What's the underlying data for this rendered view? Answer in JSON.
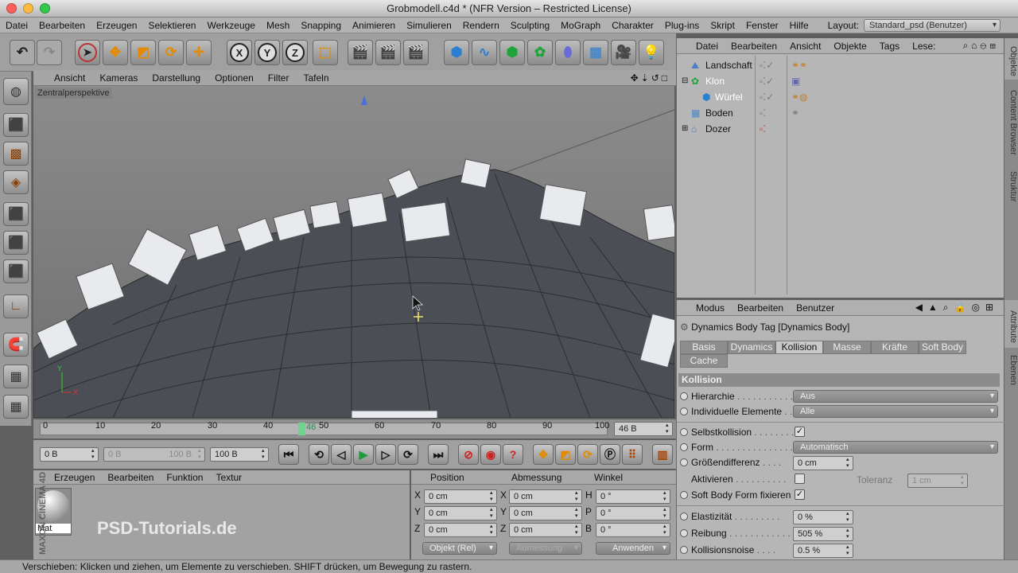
{
  "window": {
    "title": "Grobmodell.c4d * (NFR Version – Restricted License)"
  },
  "menu": [
    "Datei",
    "Bearbeiten",
    "Erzeugen",
    "Selektieren",
    "Werkzeuge",
    "Mesh",
    "Snapping",
    "Animieren",
    "Simulieren",
    "Rendern",
    "Sculpting",
    "MoGraph",
    "Charakter",
    "Plug-ins",
    "Skript",
    "Fenster",
    "Hilfe"
  ],
  "layout": {
    "label": "Layout:",
    "value": "Standard_psd (Benutzer)"
  },
  "viewport": {
    "menu": [
      "Ansicht",
      "Kameras",
      "Darstellung",
      "Optionen",
      "Filter",
      "Tafeln"
    ],
    "perspective_label": "Zentralperspektive",
    "nav_icons": "✥⇣↺□"
  },
  "timeline": {
    "ticks": [
      "0",
      "10",
      "20",
      "30",
      "40",
      "50",
      "60",
      "70",
      "80",
      "90",
      "100"
    ],
    "current": "46",
    "frame_field": "46 B"
  },
  "transport": {
    "start": "0 B",
    "range_start": "0 B",
    "range_end": "100 B",
    "end": "100 B"
  },
  "materials": {
    "menu": [
      "Erzeugen",
      "Bearbeiten",
      "Funktion",
      "Textur"
    ],
    "material_name": "Mat"
  },
  "coordinates": {
    "headers": [
      "Position",
      "Abmessung",
      "Winkel"
    ],
    "rows": [
      {
        "a": "X",
        "pos": "0 cm",
        "b": "X",
        "size": "0 cm",
        "c": "H",
        "rot": "0 °"
      },
      {
        "a": "Y",
        "pos": "0 cm",
        "b": "Y",
        "size": "0 cm",
        "c": "P",
        "rot": "0 °"
      },
      {
        "a": "Z",
        "pos": "0 cm",
        "b": "Z",
        "size": "0 cm",
        "c": "B",
        "rot": "0 °"
      }
    ],
    "mode": "Objekt (Rel)",
    "size_mode": "Abmessung",
    "apply": "Anwenden"
  },
  "objects": {
    "menu": [
      "Datei",
      "Bearbeiten",
      "Ansicht",
      "Objekte",
      "Tags",
      "Lese:"
    ],
    "items": [
      "Landschaft",
      "Klon",
      "Würfel",
      "Boden",
      "Dozer"
    ]
  },
  "side_tabs": {
    "right_top": [
      "Objekte",
      "Content Browser",
      "Struktur"
    ],
    "right_bottom": [
      "Attribute",
      "Ebenen"
    ]
  },
  "attributes": {
    "menu": [
      "Modus",
      "Bearbeiten",
      "Benutzer"
    ],
    "title": "Dynamics Body Tag [Dynamics Body]",
    "tabs": [
      "Basis",
      "Dynamics",
      "Kollision",
      "Masse",
      "Kräfte",
      "Soft Body",
      "Cache"
    ],
    "section": "Kollision",
    "hierarchie": {
      "label": "Hierarchie",
      "value": "Aus"
    },
    "individuelle": {
      "label": "Individuelle Elemente",
      "value": "Alle"
    },
    "selbst": {
      "label": "Selbstkollision",
      "checked": true
    },
    "form": {
      "label": "Form",
      "value": "Automatisch"
    },
    "groesse": {
      "label": "Größendifferenz",
      "value": "0 cm"
    },
    "aktivieren": {
      "label": "Aktivieren"
    },
    "toleranz": {
      "label": "Toleranz",
      "value": "1 cm"
    },
    "softbody": {
      "label": "Soft Body Form fixieren",
      "checked": true
    },
    "elast": {
      "label": "Elastizität",
      "value": "0 %"
    },
    "reibung": {
      "label": "Reibung",
      "value": "505 %"
    },
    "noise": {
      "label": "Kollisionsnoise",
      "value": "0.5 %"
    }
  },
  "watermark": {
    "brand": "PSD-Tutorials.de",
    "vendor": "MAXON CINEMA 4D"
  },
  "status": "Verschieben: Klicken und ziehen, um Elemente zu verschieben. SHIFT drücken, um Bewegung zu rastern."
}
